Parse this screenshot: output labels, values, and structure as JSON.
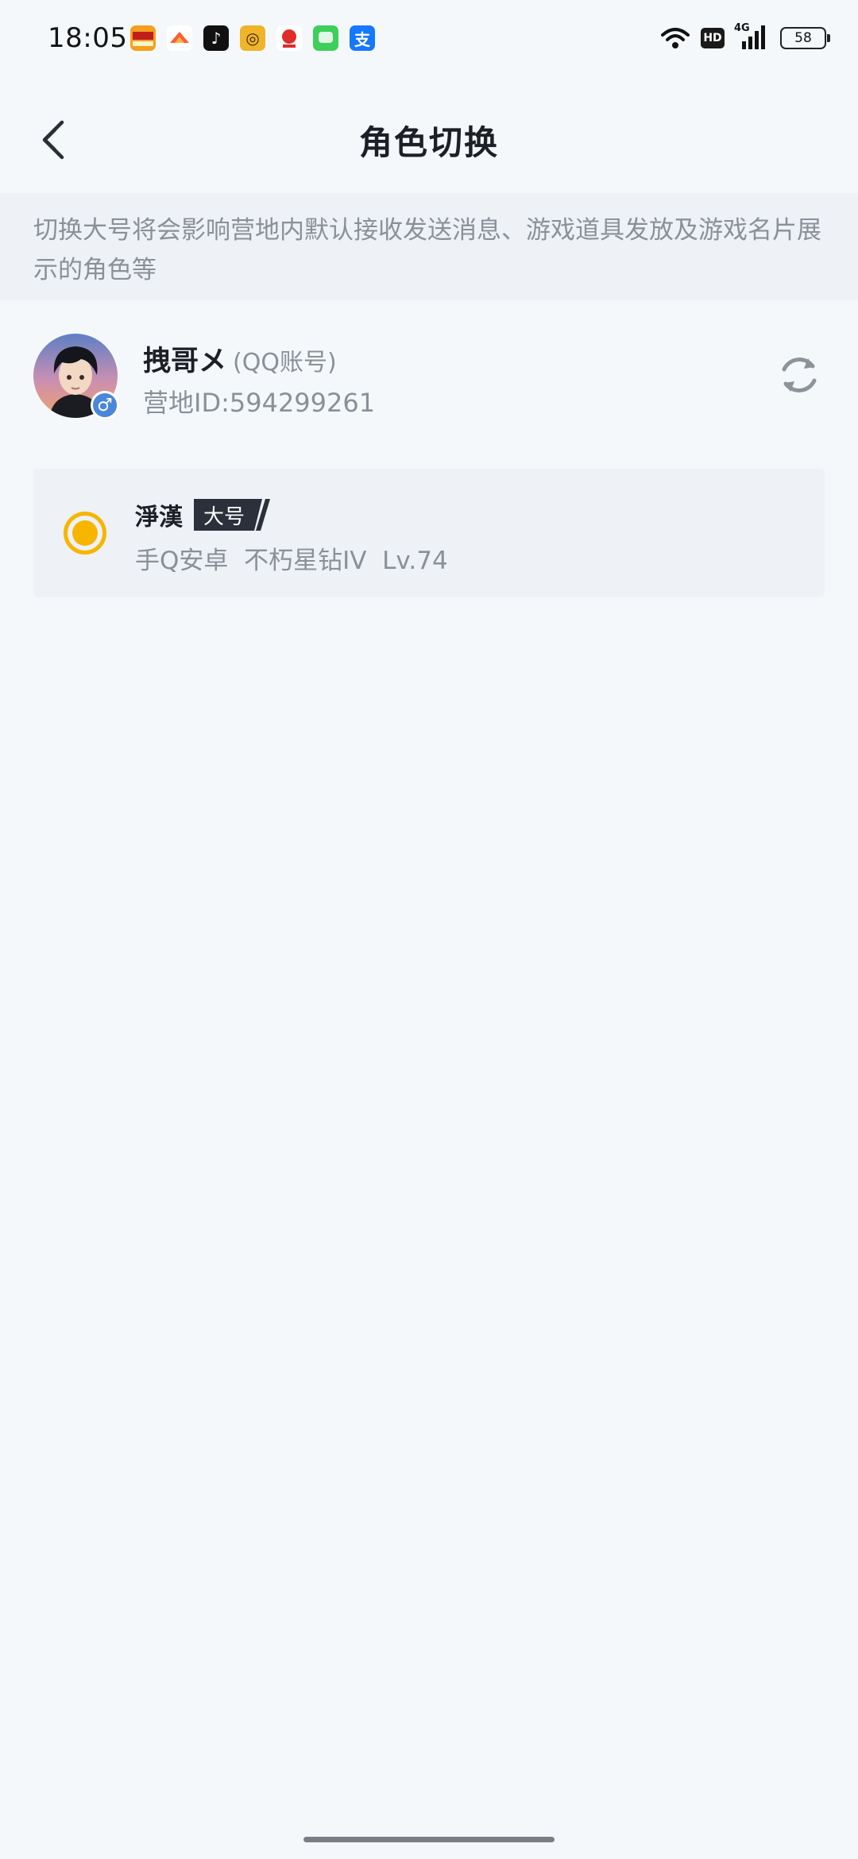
{
  "status_bar": {
    "time": "18:05",
    "app_icons": [
      {
        "name": "game-app-icon",
        "color": "#f2a01e",
        "glyph": ""
      },
      {
        "name": "fan-app-icon",
        "color": "#ffffff",
        "glyph": ""
      },
      {
        "name": "tiktok-app-icon",
        "color": "#111111",
        "glyph": "♪"
      },
      {
        "name": "music-app-icon",
        "color": "#f0b42a",
        "glyph": "◎"
      },
      {
        "name": "shopping-app-icon",
        "color": "#ffffff",
        "glyph": ""
      },
      {
        "name": "messages-app-icon",
        "color": "#3ccf5a",
        "glyph": ""
      },
      {
        "name": "alipay-app-icon",
        "color": "#1677ff",
        "glyph": "支"
      }
    ],
    "hd_label": "HD",
    "network_label": "4G",
    "battery": "58"
  },
  "header": {
    "title": "角色切换"
  },
  "notice": {
    "text": "切换大号将会影响营地内默认接收发送消息、游戏道具发放及游戏名片展示的角色等"
  },
  "account": {
    "name": "拽哥メ",
    "account_type": "(QQ账号)",
    "camp_id": "营地ID:594299261",
    "gender_symbol": "♂"
  },
  "roles": [
    {
      "name": "淨漢",
      "tag": "大号",
      "description": "手Q安卓  不朽星钻IV  Lv.74",
      "selected": true
    }
  ],
  "colors": {
    "accent": "#f7b500",
    "tag_bg": "#2b303b",
    "gender_badge": "#4a86d9",
    "page_bg": "#f5f8fb",
    "card_bg": "#eef1f5"
  }
}
